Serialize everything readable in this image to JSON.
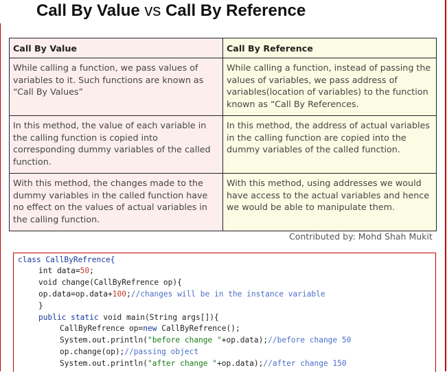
{
  "title": {
    "left": "Call By Value",
    "vs": "vs",
    "right": "Call By Reference"
  },
  "table": {
    "headers": [
      "Call By Value",
      "Call By Reference"
    ],
    "rows": [
      [
        "While calling a function, we pass values of variables to it. Such functions are known as “Call By Values”",
        "While calling a function, instead of passing the values of variables, we pass address of variables(location of variables) to the function known as “Call By References."
      ],
      [
        "In this method, the value of each variable in the calling function is copied into corresponding dummy variables of the called function.",
        "In this method, the address of actual variables in the calling function are copied into the dummy variables of the called function."
      ],
      [
        "With this method, the changes made to the dummy variables in the called function have no effect on the values of actual variables in the calling function.",
        "With this method, using addresses we would have access to the actual variables and hence we would be able to manipulate them."
      ]
    ]
  },
  "contributor": "Contributed by: Mohd Shah Mukit",
  "code": {
    "l1_kw": "class",
    "l1_name": " CallByRefrence{",
    "l2_a": "int data=",
    "l2_num": "50",
    "l2_b": ";",
    "l3": "void change(CallByRefrence op){",
    "l4_a": "op.data=op.data+",
    "l4_num": "100",
    "l4_b": ";",
    "l4_cm": "//changes will be in the instance variable",
    "l5": "}",
    "l6_kw1": "public",
    "l6_kw2": "static",
    "l6_rest": " void main(String args[]){",
    "l7_a": "CallByRefrence op=",
    "l7_kw": "new",
    "l7_b": " CallByRefrence();",
    "l8_a": "System.out.println(",
    "l8_str": "\"before change \"",
    "l8_b": "+op.data);",
    "l8_cm": "//before change 50",
    "l9_a": "op.change(op);",
    "l9_cm": "//passing object",
    "l10_a": "System.out.println(",
    "l10_str": "\"after change \"",
    "l10_b": "+op.data);",
    "l10_cm": "//after change 150"
  }
}
